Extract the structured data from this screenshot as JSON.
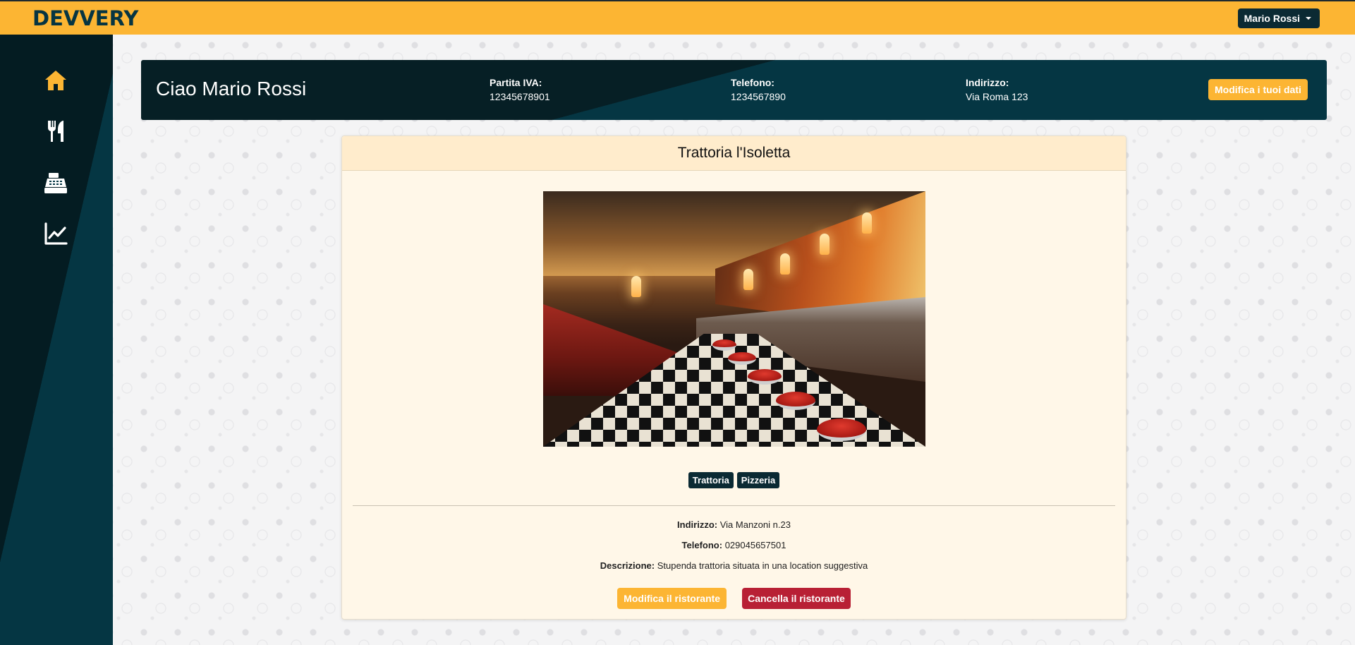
{
  "navbar": {
    "logo_text": "DEVVERY",
    "user_menu_label": "Mario Rossi"
  },
  "sidebar": {
    "items": [
      {
        "icon": "home-icon",
        "color": "#fcb533"
      },
      {
        "icon": "utensils-icon",
        "color": "#ffffff"
      },
      {
        "icon": "cash-register-icon",
        "color": "#ffffff"
      },
      {
        "icon": "chart-line-icon",
        "color": "#ffffff"
      }
    ]
  },
  "hero": {
    "greeting": "Ciao Mario Rossi",
    "vat_label": "Partita IVA:",
    "vat_value": "12345678901",
    "phone_label": "Telefono:",
    "phone_value": "1234567890",
    "address_label": "Indirizzo:",
    "address_value": "Via Roma 123",
    "edit_button": "Modifica i tuoi dati"
  },
  "restaurant": {
    "name": "Trattoria l'Isoletta",
    "tags": [
      "Trattoria",
      "Pizzeria"
    ],
    "address_label": "Indirizzo:",
    "address": "Via Manzoni n.23",
    "phone_label": "Telefono:",
    "phone": "029045657501",
    "description_label": "Descrizione:",
    "description": "Stupenda trattoria situata in una location suggestiva",
    "edit_button": "Modifica il ristorante",
    "delete_button": "Cancella il ristorante"
  },
  "colors": {
    "accent": "#fcb533",
    "dark": "#053643",
    "danger": "#b82035"
  }
}
